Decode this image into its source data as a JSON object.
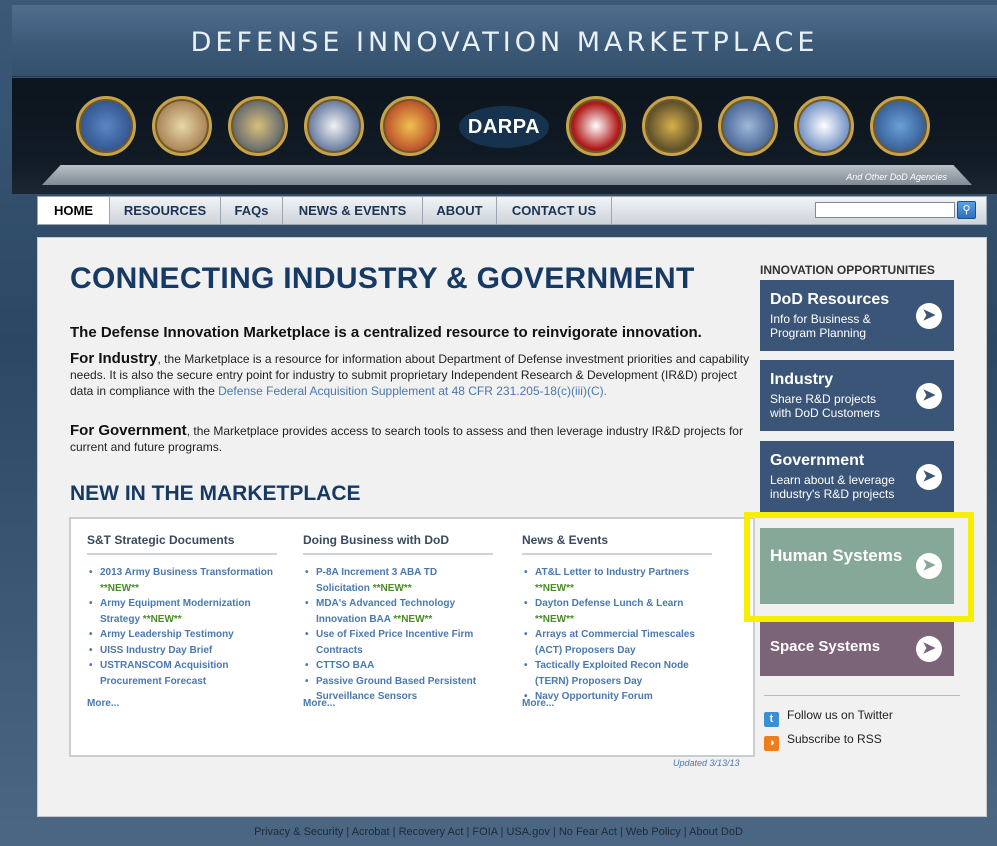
{
  "header": {
    "site_title": "DEFENSE INNOVATION MARKETPLACE",
    "darpa_label": "DARPA",
    "other_agencies": "And Other DoD Agencies"
  },
  "nav": {
    "items": [
      "HOME",
      "RESOURCES",
      "FAQs",
      "NEWS & EVENTS",
      "ABOUT",
      "CONTACT US"
    ],
    "active": "HOME",
    "search_value": ""
  },
  "main": {
    "hero_title": "CONNECTING INDUSTRY & GOVERNMENT",
    "hero_subtitle": "The Defense Innovation Marketplace is a centralized resource to reinvigorate innovation.",
    "industry": {
      "lead": "For Industry",
      "text": ", the Marketplace is a resource for information about Department of Defense investment priorities and capability needs. It is also the secure entry point for industry to submit proprietary Independent Research & Development (IR&D) project data in compliance with the ",
      "link": "Defense Federal Acquisition Supplement at 48 CFR 231.205-18(c)(iii)(C)."
    },
    "government": {
      "lead": "For Government",
      "text": ", the Marketplace provides access to search tools to assess and then leverage industry IR&D projects for current and future programs."
    },
    "section_title": "NEW IN THE MARKETPLACE",
    "columns": [
      {
        "title": "S&T Strategic Documents",
        "items": [
          {
            "text": "2013 Army Business Transformation",
            "new": "**NEW**"
          },
          {
            "text": "Army Equipment Modernization Strategy",
            "new": "**NEW**"
          },
          {
            "text": "Army Leadership Testimony",
            "new": ""
          },
          {
            "text": "UISS Industry Day Brief",
            "new": ""
          },
          {
            "text": "USTRANSCOM Acquisition Procurement Forecast",
            "new": ""
          }
        ],
        "more": "More..."
      },
      {
        "title": "Doing Business with DoD",
        "items": [
          {
            "text": "P-8A Increment 3 ABA TD Solicitation",
            "new": "**NEW**"
          },
          {
            "text": "MDA's Advanced Technology Innovation BAA",
            "new": "**NEW**"
          },
          {
            "text": "Use of Fixed Price Incentive Firm Contracts",
            "new": ""
          },
          {
            "text": "CTTSO BAA",
            "new": ""
          },
          {
            "text": "Passive Ground Based Persistent Surveillance Sensors",
            "new": ""
          }
        ],
        "more": "More..."
      },
      {
        "title": "News & Events",
        "items": [
          {
            "text": "AT&L Letter to Industry Partners",
            "new": "**NEW**"
          },
          {
            "text": "Dayton Defense Lunch & Learn",
            "new": "**NEW**"
          },
          {
            "text": "Arrays at Commercial Timescales (ACT) Proposers Day",
            "new": ""
          },
          {
            "text": "Tactically Exploited Recon Node (TERN) Proposers Day",
            "new": ""
          },
          {
            "text": "Navy Opportunity Forum",
            "new": ""
          }
        ],
        "more": "More..."
      }
    ],
    "updated": "Updated 3/13/13"
  },
  "sidebar": {
    "heading": "INNOVATION OPPORTUNITIES",
    "cards": [
      {
        "title": "DoD Resources",
        "desc": "Info for Business & Program Planning",
        "color": "#3a5577"
      },
      {
        "title": "Industry",
        "desc": "Share R&D projects with DoD Customers",
        "color": "#3a5577"
      },
      {
        "title": "Government",
        "desc": "Learn about & leverage industry's R&D projects",
        "color": "#3a5577"
      },
      {
        "title": "Human Systems",
        "desc": "",
        "color": "#86a898"
      },
      {
        "title": "Space Systems",
        "desc": "",
        "color": "#7b6378"
      }
    ],
    "twitter": "Follow us on Twitter",
    "rss": "Subscribe to RSS"
  },
  "footer": {
    "links": [
      "Privacy & Security",
      "Acrobat",
      "Recovery Act",
      "FOIA",
      "USA.gov",
      "No Fear Act",
      "Web Policy",
      "About DoD"
    ]
  }
}
